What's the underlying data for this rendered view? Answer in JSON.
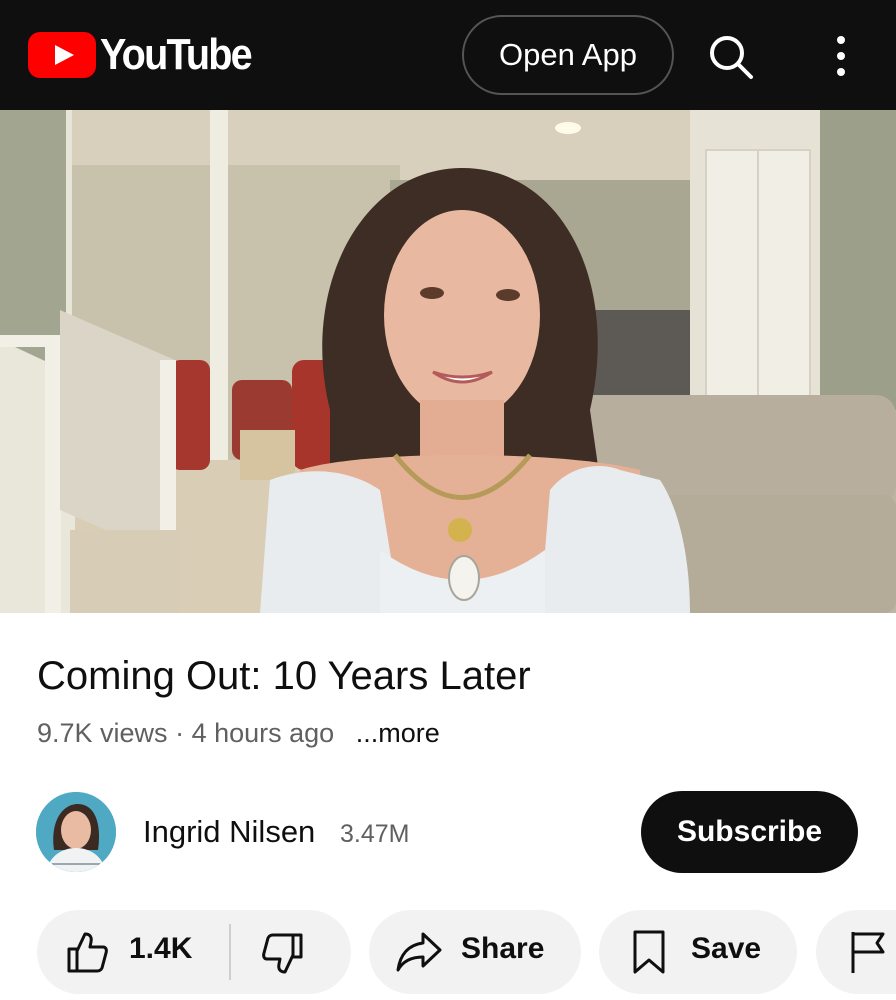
{
  "header": {
    "logo_text": "YouTube",
    "open_app_label": "Open App",
    "search_icon": "search-icon",
    "more_icon": "more-vert-icon"
  },
  "video": {
    "title": "Coming Out: 10 Years Later",
    "views": "9.7K views",
    "separator": "·",
    "age": "4 hours ago",
    "more_label": "...more"
  },
  "channel": {
    "name": "Ingrid Nilsen",
    "subscribers": "3.47M",
    "subscribe_label": "Subscribe"
  },
  "actions": {
    "like_count": "1.4K",
    "share_label": "Share",
    "save_label": "Save",
    "like_icon": "thumbs-up-icon",
    "dislike_icon": "thumbs-down-icon",
    "share_icon": "share-arrow-icon",
    "save_icon": "bookmark-icon",
    "report_icon": "flag-icon"
  },
  "colors": {
    "brand_red": "#ff0000",
    "topbar_bg": "#0f0f0f",
    "pill_bg": "#f2f2f2",
    "secondary_text": "#606060"
  }
}
